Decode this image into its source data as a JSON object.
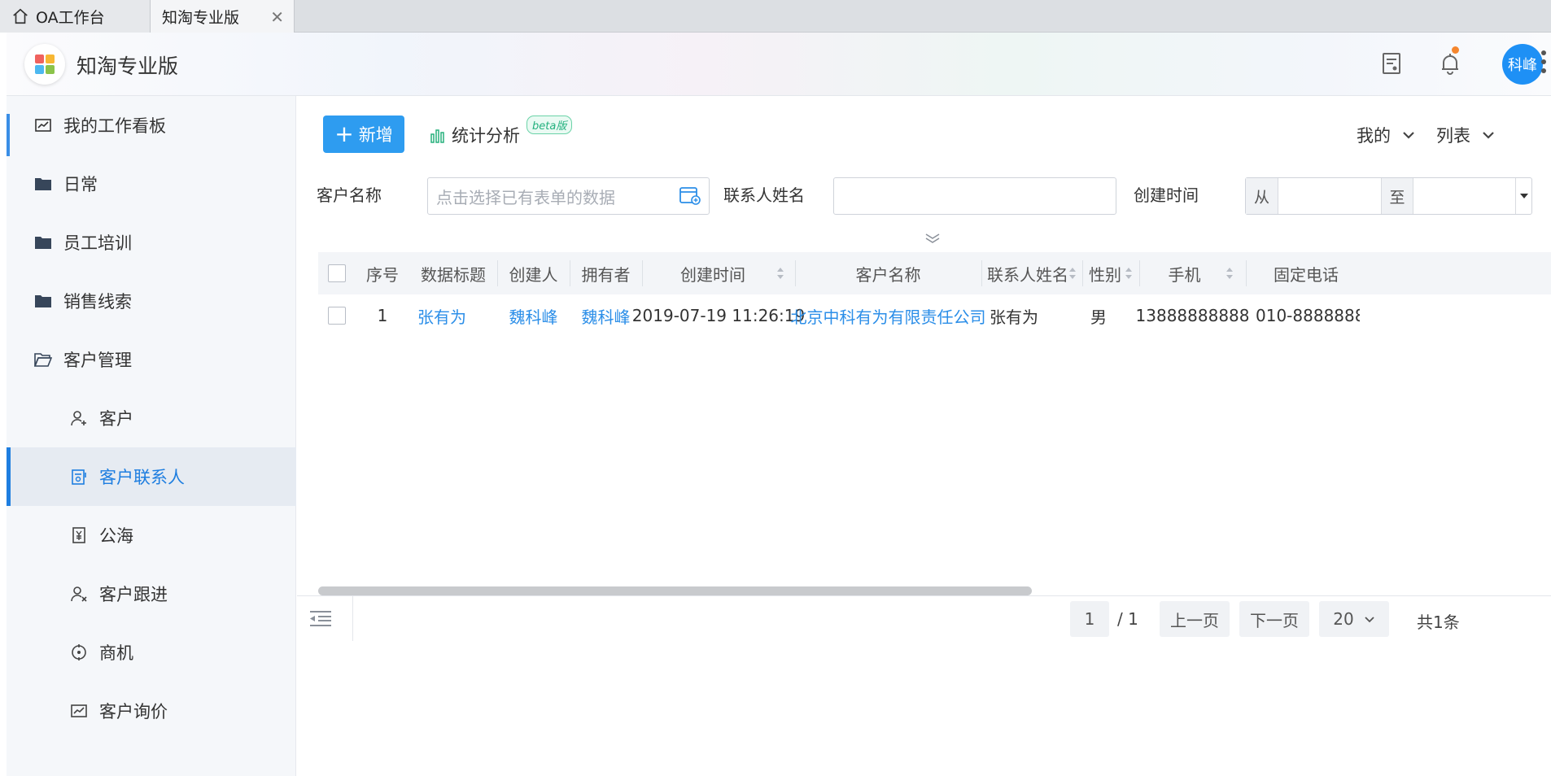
{
  "tabs": {
    "home_label": "OA工作台",
    "active_label": "知淘专业版",
    "close_symbol": "✕"
  },
  "header": {
    "app_title": "知淘专业版",
    "user_name": "科峰"
  },
  "sidebar": {
    "items": [
      {
        "label": "我的工作看板",
        "icon": "chart-icon"
      },
      {
        "label": "日常",
        "icon": "folder-icon"
      },
      {
        "label": "员工培训",
        "icon": "folder-icon"
      },
      {
        "label": "销售线索",
        "icon": "folder-icon"
      },
      {
        "label": "客户管理",
        "icon": "folder-open-icon"
      },
      {
        "label": "客户",
        "icon": "user-plus-icon"
      },
      {
        "label": "客户联系人",
        "icon": "contact-card-icon"
      },
      {
        "label": "公海",
        "icon": "yen-doc-icon"
      },
      {
        "label": "客户跟进",
        "icon": "user-x-icon"
      },
      {
        "label": "商机",
        "icon": "target-icon"
      },
      {
        "label": "客户询价",
        "icon": "trend-chart-icon"
      }
    ]
  },
  "toolbar": {
    "add_label": "新增",
    "add_symbol": "+",
    "stats_label": "统计分析",
    "beta_label": "beta版",
    "scope_label": "我的",
    "view_label": "列表"
  },
  "filters": {
    "customer_name_label": "客户名称",
    "customer_name_placeholder": "点击选择已有表单的数据",
    "contact_name_label": "联系人姓名",
    "created_label": "创建时间",
    "from_label": "从",
    "to_label": "至"
  },
  "table": {
    "columns": [
      "序号",
      "数据标题",
      "创建人",
      "拥有者",
      "创建时间",
      "客户名称",
      "联系人姓名",
      "性别",
      "手机",
      "固定电话"
    ],
    "rows": [
      [
        "1",
        "张有为",
        "魏科峰",
        "魏科峰",
        "2019-07-19 11:26:19",
        "北京中科有为有限责任公司",
        "张有为",
        "男",
        "13888888888",
        "010-8888888"
      ]
    ]
  },
  "pagination": {
    "current_page": "1",
    "total_pages": "/ 1",
    "prev_label": "上一页",
    "next_label": "下一页",
    "page_size": "20",
    "total_label": "共1条"
  },
  "colors": {
    "accent": "#1e7ee0",
    "primary_button": "#2e9cf0",
    "link": "#2b8ee8",
    "avatar": "#1e90f5",
    "notification_dot": "#f5862d"
  }
}
